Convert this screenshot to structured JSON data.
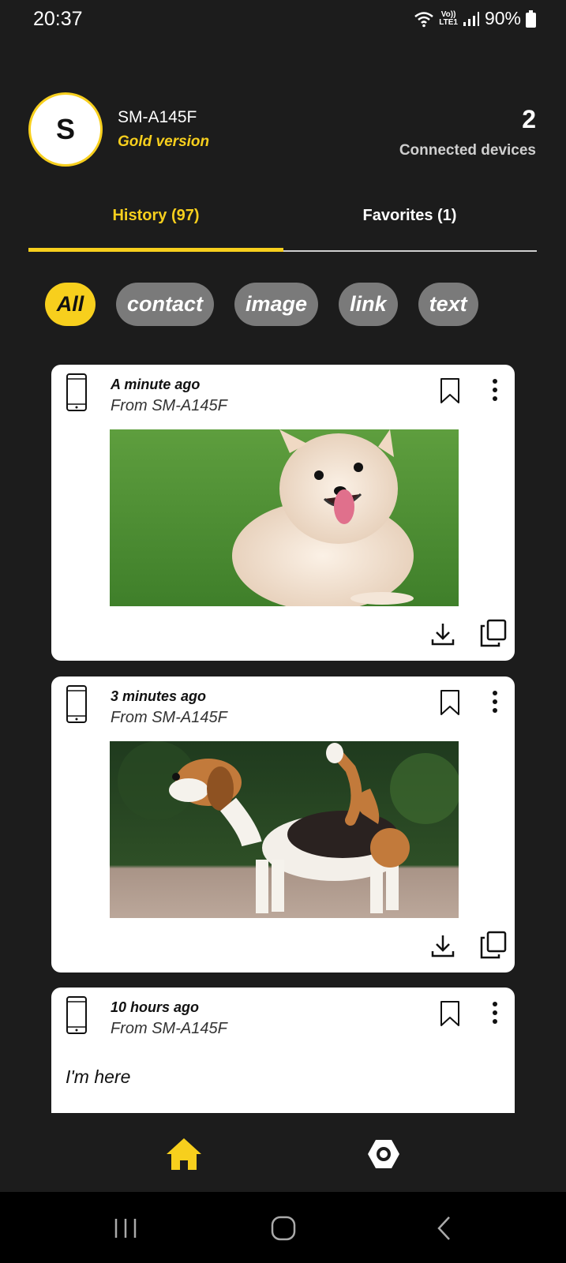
{
  "status_bar": {
    "time": "20:37",
    "volte_label": "Vo))",
    "lte_label": "LTE1",
    "battery": "90%"
  },
  "header": {
    "avatar_letter": "S",
    "device_name": "SM-A145F",
    "version": "Gold version",
    "connected_count": "2",
    "connected_label": "Connected devices"
  },
  "tabs": [
    {
      "label": "History (97)",
      "active": true
    },
    {
      "label": "Favorites (1)",
      "active": false
    }
  ],
  "chips": [
    {
      "label": "All",
      "active": true
    },
    {
      "label": "contact",
      "active": false
    },
    {
      "label": "image",
      "active": false
    },
    {
      "label": "link",
      "active": false
    },
    {
      "label": "text",
      "active": false
    }
  ],
  "cards": [
    {
      "time": "A minute ago",
      "from": "From SM-A145F",
      "type": "image",
      "image_icon": "pomeranian-dog-photo"
    },
    {
      "time": "3 minutes ago",
      "from": "From SM-A145F",
      "type": "image",
      "image_icon": "beagle-dog-photo"
    },
    {
      "time": "10 hours ago",
      "from": "From SM-A145F",
      "type": "text",
      "text": "I'm here"
    }
  ],
  "colors": {
    "accent": "#f7cf1d",
    "background": "#1c1c1c",
    "chip_inactive": "#7a7a7a",
    "card": "#ffffff"
  },
  "icons": {
    "nav_home": "home-icon",
    "nav_settings": "settings-icon",
    "card_device": "phone-icon",
    "card_bookmark": "bookmark-icon",
    "card_more": "more-vertical-icon",
    "card_download": "download-icon",
    "card_copy": "copy-icon"
  }
}
